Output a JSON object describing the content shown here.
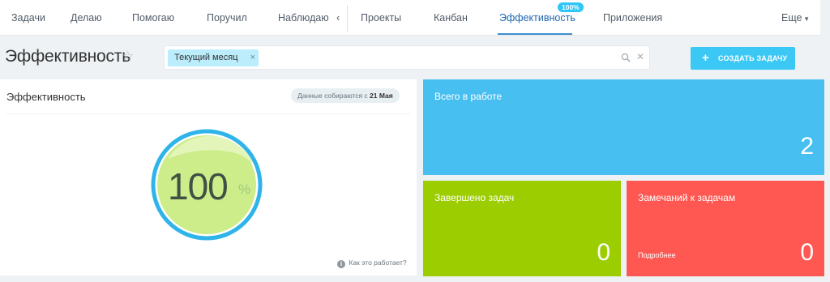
{
  "nav": {
    "items": [
      "Задачи",
      "Делаю",
      "Помогаю",
      "Поручил",
      "Наблюдаю",
      "Проекты",
      "Канбан",
      "Эффективность",
      "Приложения",
      "Еще"
    ],
    "active": "Эффективность",
    "active_badge": "100%",
    "more_arrow": "▾"
  },
  "header": {
    "title": "Эффективность",
    "create_button": "Создать задачу"
  },
  "filter": {
    "chip_label": "Текущий месяц",
    "search_placeholder": ""
  },
  "efficiency_card": {
    "title": "Эффективность",
    "since_prefix": "Данные собираются с",
    "since_date": "21 Мая",
    "gauge_value": "100",
    "gauge_unit": "%",
    "gauge_level": 1.0,
    "how_link": "Как это работает?"
  },
  "stats": {
    "in_work_label": "Всего в работе",
    "in_work_value": "2",
    "completed_label": "Завершено задач",
    "completed_value": "0",
    "remarks_label": "Замечаний к задачам",
    "remarks_value": "0",
    "remarks_more": "Подробнее"
  },
  "colors": {
    "accent": "#3bc8f5",
    "tile_blue": "#47bff1",
    "tile_green": "#9ccd01",
    "tile_red": "#ff5752",
    "gauge_ring": "#2fb4ea",
    "gauge_fill": "#cdec8a"
  }
}
